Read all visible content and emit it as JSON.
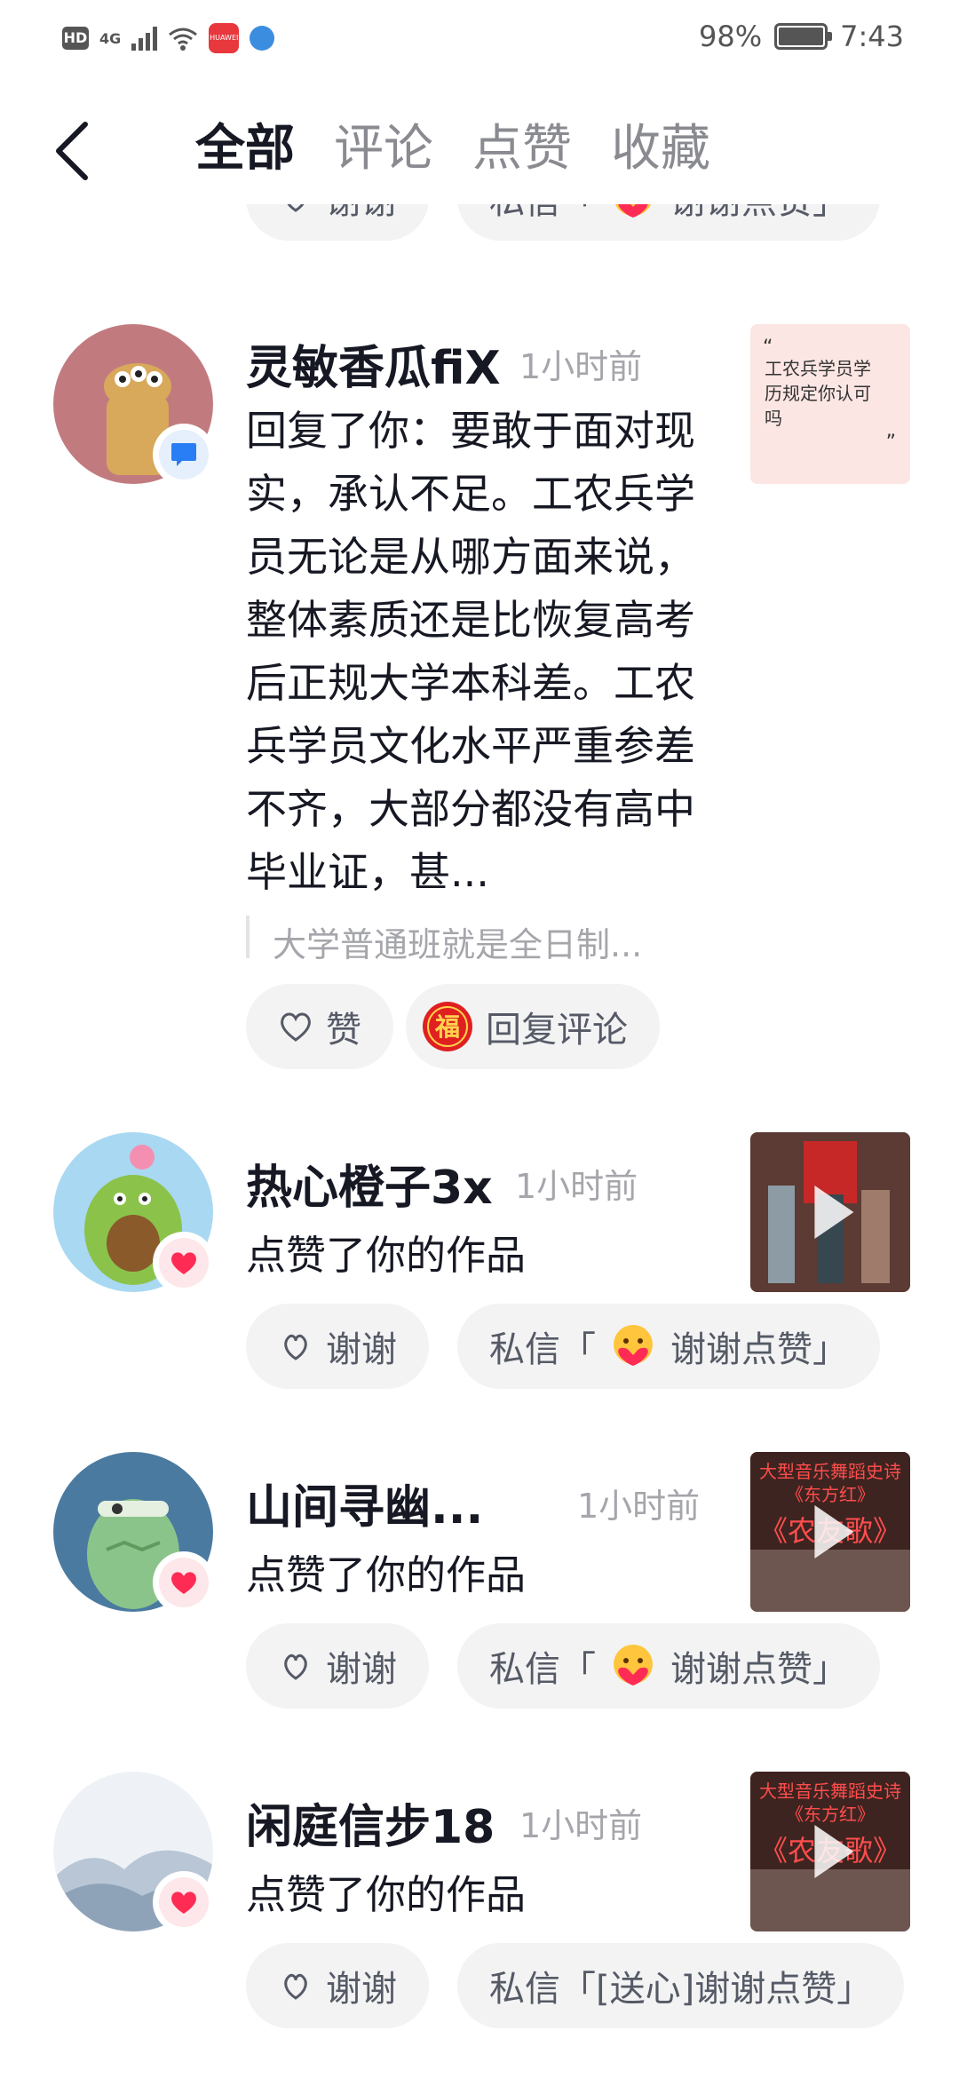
{
  "status_bar": {
    "hd": "HD",
    "network": "4G",
    "battery_pct": "98%",
    "time": "7:43",
    "app_icon": "huawei-store-icon"
  },
  "tabs": [
    {
      "label": "全部",
      "active": true
    },
    {
      "label": "评论",
      "active": false
    },
    {
      "label": "点赞",
      "active": false
    },
    {
      "label": "收藏",
      "active": false
    }
  ],
  "partial_row": {
    "thanks_label": "谢谢",
    "dm_label": "私信「",
    "dm_suffix": "谢谢点赞」"
  },
  "notifications": [
    {
      "username": "灵敏香瓜fiX",
      "time": "1小时前",
      "content": "回复了你：要敢于面对现实，承认不足。工农兵学员无论是从哪方面来说，整体素质还是比恢复高考后正规大学本科差。工农兵学员文化水平严重参差不齐，大部分都没有高中毕业证，甚...",
      "quote": "大学普通班就是全日制...",
      "thumb_text": "工农兵学员学历规定你认可吗",
      "like_label": "赞",
      "reply_label": "回复评论",
      "badge": "comment"
    },
    {
      "username": "热心橙子3x",
      "time": "1小时前",
      "content": "点赞了你的作品",
      "thanks_label": "谢谢",
      "dm_label": "私信「",
      "dm_suffix": "谢谢点赞」",
      "badge": "like"
    },
    {
      "username": "山间寻幽...",
      "time": "1小时前",
      "content": "点赞了你的作品",
      "thumb_caption_1": "大型音乐舞蹈史诗",
      "thumb_caption_2": "《东方红》",
      "thumb_caption_3": "《农友歌》",
      "thanks_label": "谢谢",
      "dm_label": "私信「",
      "dm_suffix": "谢谢点赞」",
      "badge": "like"
    },
    {
      "username": "闲庭信步18",
      "time": "1小时前",
      "content": "点赞了你的作品",
      "thumb_caption_1": "大型音乐舞蹈史诗",
      "thumb_caption_2": "《东方红》",
      "thumb_caption_3": "《农友歌》",
      "thanks_label": "谢谢",
      "dm_full": "私信「[送心]谢谢点赞」",
      "badge": "like"
    }
  ],
  "colors": {
    "text_primary": "#161823",
    "text_secondary": "#a5a6ab",
    "chip_bg": "#f3f3f4",
    "like_red": "#fe2c55",
    "comment_blue": "#2a7ef5"
  }
}
